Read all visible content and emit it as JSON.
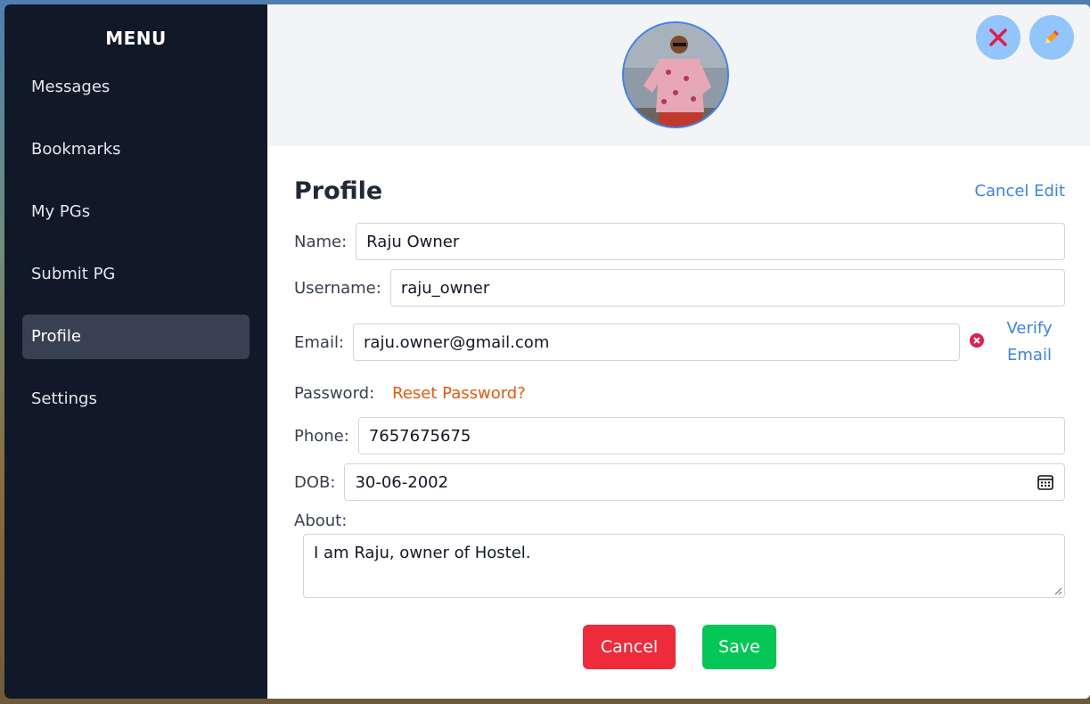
{
  "sidebar": {
    "title": "MENU",
    "items": [
      {
        "label": "Messages"
      },
      {
        "label": "Bookmarks"
      },
      {
        "label": "My PGs"
      },
      {
        "label": "Submit PG"
      },
      {
        "label": "Profile"
      },
      {
        "label": "Settings"
      }
    ],
    "active": "Profile"
  },
  "header": {
    "avatar_icon": "user-photo",
    "close_icon": "x-icon",
    "edit_icon": "pencil-icon"
  },
  "profile": {
    "heading": "Profile",
    "cancel_edit_label": "Cancel Edit",
    "name_label": "Name:",
    "name_value": "Raju Owner",
    "username_label": "Username:",
    "username_value": "raju_owner",
    "email_label": "Email:",
    "email_value": "raju.owner@gmail.com",
    "verify_line1": "Verify",
    "verify_line2": "Email",
    "password_label": "Password:",
    "reset_password_label": "Reset Password?",
    "phone_label": "Phone:",
    "phone_value": "7657675675",
    "dob_label": "DOB:",
    "dob_value": "30-06-2002",
    "about_label": "About:",
    "about_value": "I am Raju, owner of Hostel."
  },
  "actions": {
    "cancel_label": "Cancel",
    "save_label": "Save"
  },
  "colors": {
    "sidebar_bg": "#111827",
    "accent": "#3b82f6",
    "cancel": "#ef2a3a",
    "save": "#04c755",
    "reset_link": "#ea580c"
  }
}
